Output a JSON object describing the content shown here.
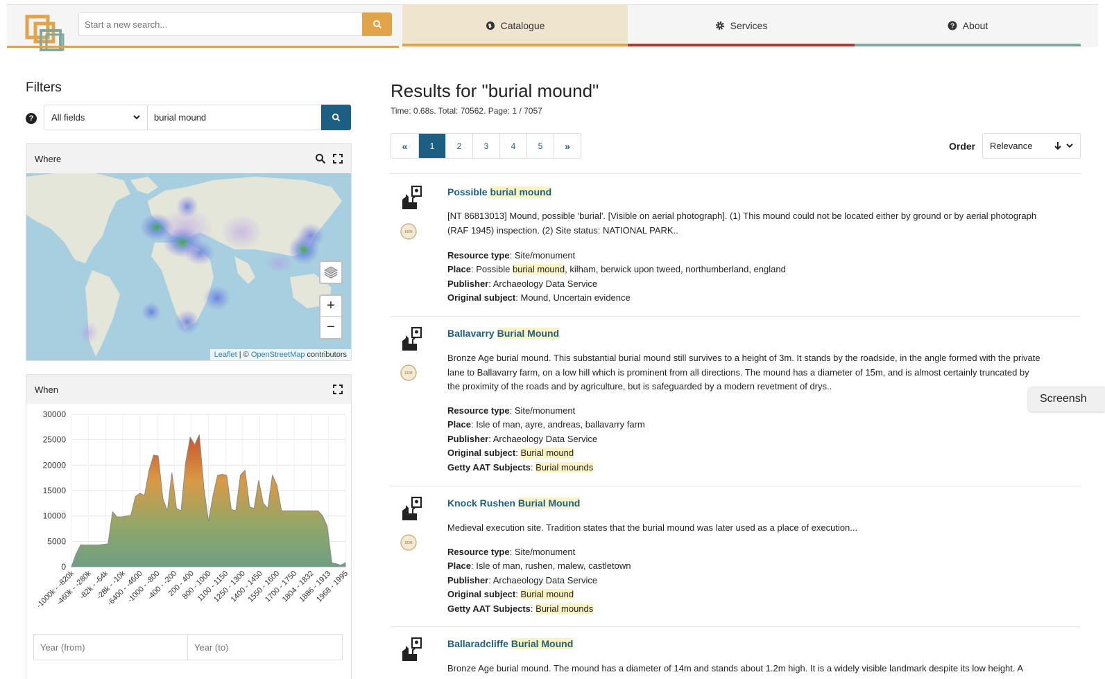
{
  "header": {
    "search_placeholder": "Start a new search...",
    "nav": [
      {
        "label": "Catalogue",
        "icon": "globe-icon"
      },
      {
        "label": "Services",
        "icon": "gear-icon"
      },
      {
        "label": "About",
        "icon": "question-circle-icon"
      }
    ]
  },
  "filters": {
    "title": "Filters",
    "field_select": "All fields",
    "query": "burial mound",
    "where": {
      "title": "Where",
      "attribution": {
        "leaflet": "Leaflet",
        "sep": " | © ",
        "osm": "OpenStreetMap",
        "contrib": " contributors"
      }
    },
    "when": {
      "title": "When",
      "year_from_placeholder": "Year (from)",
      "year_to_placeholder": "Year (to)"
    }
  },
  "chart_data": {
    "type": "area",
    "title": "",
    "y_ticks": [
      0,
      5000,
      10000,
      15000,
      20000,
      25000,
      30000
    ],
    "ylim": [
      0,
      30000
    ],
    "x_tick_labels": [
      "-1000k - -820k",
      "-460k - -280k",
      "-82k - -64k",
      "-28k - -10k",
      "-6400 - -4600",
      "-1000 - -800",
      "-400 - -200",
      "200 - 400",
      "800 - 1000",
      "1100 - 1150",
      "1250 - 1300",
      "1400 - 1450",
      "1550 - 1600",
      "1700 - 1750",
      "1804 - 1832",
      "1886 - 1913",
      "1968 - 1995"
    ],
    "values": [
      0,
      2500,
      4300,
      4300,
      4300,
      4300,
      4300,
      4400,
      4500,
      10800,
      9800,
      9800,
      10000,
      10100,
      13800,
      14500,
      14000,
      19000,
      22000,
      21800,
      13500,
      11000,
      18500,
      11500,
      11000,
      20500,
      25500,
      24000,
      26000,
      15500,
      9000,
      14000,
      18000,
      18200,
      18000,
      11300,
      11000,
      18000,
      19000,
      11800,
      11500,
      17000,
      12500,
      11500,
      18000,
      16000,
      11000,
      11000,
      11000,
      11000,
      11000,
      11000,
      11000,
      11000,
      11000,
      10000,
      8000,
      800,
      600,
      300,
      800
    ]
  },
  "results": {
    "title": "Results for \"burial mound\"",
    "meta": "Time: 0.68s. Total: 70562. Page: 1 / 7057",
    "pages": [
      "«",
      "1",
      "2",
      "3",
      "4",
      "5",
      "»"
    ],
    "current_page": "1",
    "order_label": "Order",
    "order_value": "Relevance",
    "labels": {
      "resource_type": "Resource type",
      "place": "Place",
      "publisher": "Publisher",
      "original_subject": "Original subject",
      "getty": "Getty AAT Subjects"
    },
    "items": [
      {
        "title_pre": "Possible ",
        "title_hl": "burial mound",
        "desc_1": "[NT 86813013] Mound, possible 'burial'. [Visible on aerial photograph]. (1) This mound could not be located either by ground or by aerial photograph",
        "desc_2": "(RAF 1945) inspection. (2) Site status: NATIONAL PARK..",
        "resource_type": "Site/monument",
        "place_pre": "Possible ",
        "place_hl": "burial mound",
        "place_post": ", kilham, berwick upon tweed, northumberland, england",
        "publisher": "Archaeology Data Service",
        "original_subject": "Mound, Uncertain evidence"
      },
      {
        "title_pre": "Ballavarry ",
        "title_hl": "Burial Mound",
        "desc_1": "Bronze Age burial mound. This substantial burial mound still survives to a height of 3m. It stands by the roadside, in the angle formed with the private",
        "desc_2": "lane to Ballavarry farm, on a low hill which is prominent from all directions. The mound has a diameter of 15m, and is almost certainly truncated by",
        "desc_3": "the proximity of the roads and by agriculture, but is safeguarded by a modern revetment of drys..",
        "resource_type": "Site/monument",
        "place": "Isle of man, ayre, andreas, ballavarry farm",
        "publisher": "Archaeology Data Service",
        "original_subject": "Burial mound",
        "getty": "Burial mounds"
      },
      {
        "title_pre": "Knock Rushen ",
        "title_hl": "Burial Mound",
        "desc_1": "Medieval execution site. Tradition states that the burial mound was later used as a place of execution...",
        "resource_type": "Site/monument",
        "place": "Isle of man, rushen, malew, castletown",
        "publisher": "Archaeology Data Service",
        "original_subject": "Burial mound",
        "getty": "Burial mounds"
      },
      {
        "title_pre": "Ballaradcliffe ",
        "title_hl": "Burial Mound",
        "desc_1": "Bronze Age burial mound. The mound has a diameter of 14m and stands about 1.2m high. It is a widely visible landmark despite its low height. A"
      }
    ]
  },
  "screenshot_tab": "Screensh"
}
